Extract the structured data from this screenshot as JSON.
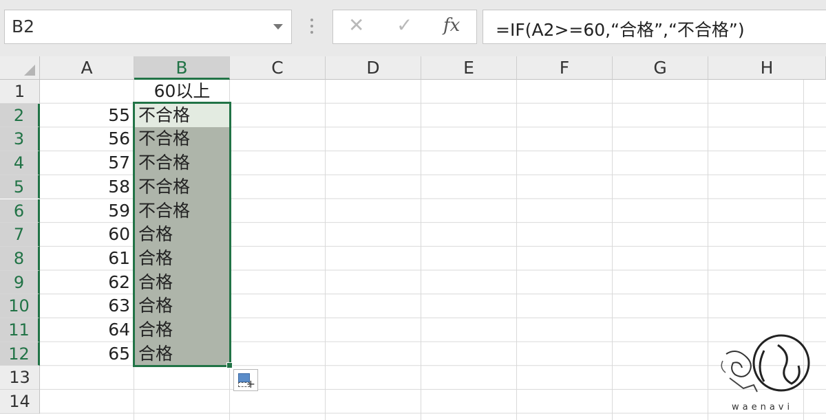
{
  "name_box": {
    "value": "B2"
  },
  "formula_bar": {
    "cancel_icon": "close-icon",
    "enter_icon": "check-icon",
    "fx_label": "fx",
    "formula": "=IF(A2>=60,“合格”,“不合格”)"
  },
  "columns": [
    "A",
    "B",
    "C",
    "D",
    "E",
    "F",
    "G",
    "H"
  ],
  "rows": [
    "1",
    "2",
    "3",
    "4",
    "5",
    "6",
    "7",
    "8",
    "9",
    "10",
    "11",
    "12",
    "13",
    "14"
  ],
  "cells": {
    "B1": "60以上",
    "A": [
      "55",
      "56",
      "57",
      "58",
      "59",
      "60",
      "61",
      "62",
      "63",
      "64",
      "65"
    ],
    "B": [
      "不合格",
      "不合格",
      "不合格",
      "不合格",
      "不合格",
      "合格",
      "合格",
      "合格",
      "合格",
      "合格",
      "合格"
    ]
  },
  "logo": {
    "text": "waenavi"
  },
  "colors": {
    "accent": "#217346",
    "selection": "#aeb5aa"
  }
}
